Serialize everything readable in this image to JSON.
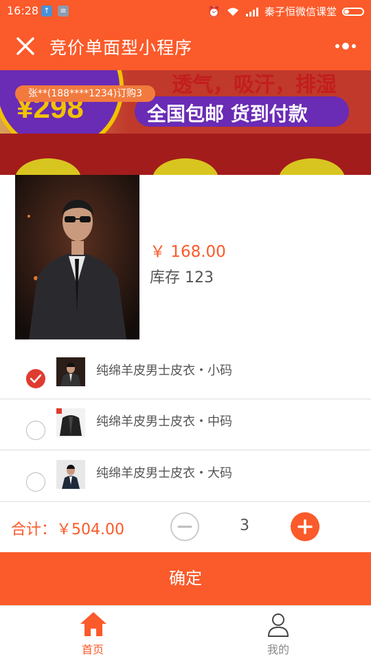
{
  "status_bar": {
    "time": "16:28",
    "carrier": "秦子恒微信课堂"
  },
  "navbar": {
    "title": "竞价单面型小程序",
    "close_icon": "close-icon",
    "more_icon": "more-dots-icon"
  },
  "banner": {
    "price_text": "¥298",
    "slogan_top": "透气，吸汗，排湿",
    "slogan_bottom": "全国包邮 货到付款",
    "buyer_notice": "张**(188****1234)订购3"
  },
  "product": {
    "price": "￥ 168.00",
    "stock": "库存 123"
  },
  "options": [
    {
      "label": "纯绵羊皮男士皮衣・小码",
      "selected": true
    },
    {
      "label": "纯绵羊皮男士皮衣・中码",
      "selected": false
    },
    {
      "label": "纯绵羊皮男士皮衣・大码",
      "selected": false
    }
  ],
  "summary": {
    "total_label": "合计：￥504.00",
    "quantity": "3"
  },
  "confirm_button": "确定",
  "tabbar": {
    "home": "首页",
    "mine": "我的"
  },
  "colors": {
    "accent": "#fb5a2a",
    "check": "#e03b2f",
    "inactive": "#888888"
  }
}
